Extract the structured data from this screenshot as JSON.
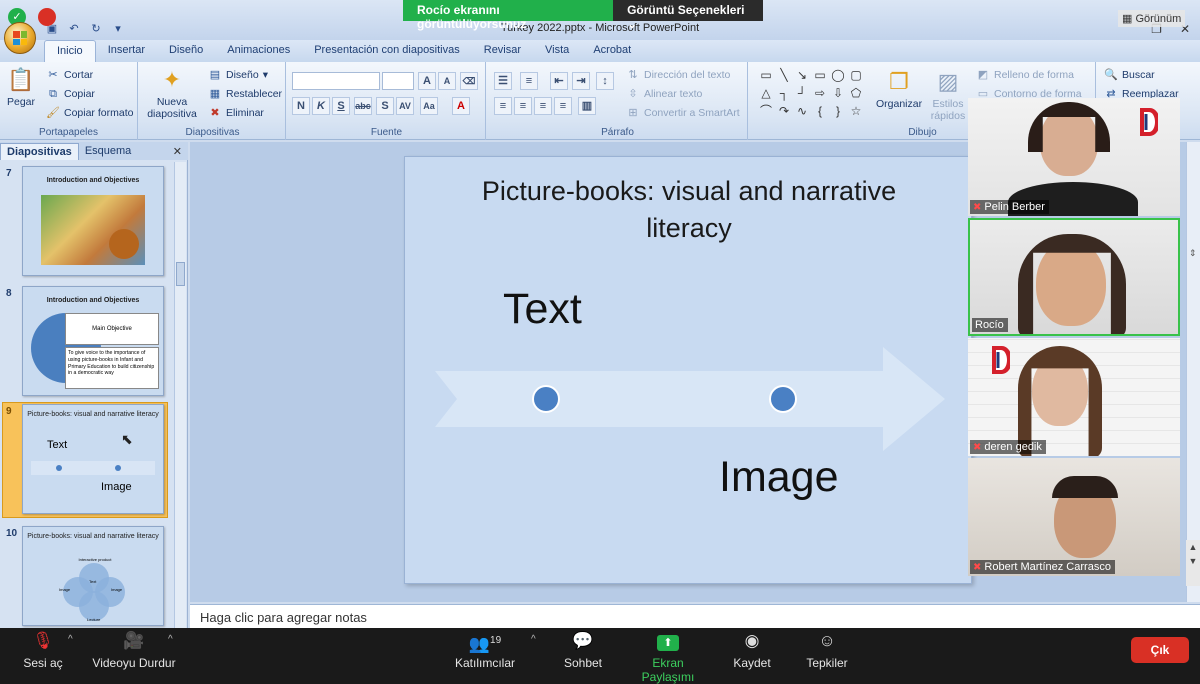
{
  "share_banner": {
    "status": "Rocío ekranını görüntülüyorsunuz",
    "options": "Görüntü Seçenekleri"
  },
  "view_label": "Görünüm",
  "ppt": {
    "window_title": "Turkey 2022.pptx - Microsoft PowerPoint",
    "tabs": [
      "Inicio",
      "Insertar",
      "Diseño",
      "Animaciones",
      "Presentación con diapositivas",
      "Revisar",
      "Vista",
      "Acrobat"
    ],
    "clipboard": {
      "paste": "Pegar",
      "cut": "Cortar",
      "copy": "Copiar",
      "format_painter": "Copiar formato",
      "label": "Portapapeles"
    },
    "slides_group": {
      "new_slide": "Nueva diapositiva",
      "layout": "Diseño",
      "reset": "Restablecer",
      "delete": "Eliminar",
      "label": "Diapositivas"
    },
    "font_group": {
      "label": "Fuente"
    },
    "paragraph_group": {
      "text_direction": "Dirección del texto",
      "align_text": "Alinear texto",
      "smartart": "Convertir a SmartArt",
      "label": "Párrafo"
    },
    "drawing_group": {
      "arrange": "Organizar",
      "quick_styles": "Estilos rápidos",
      "fill": "Relleno de forma",
      "outline": "Contorno de forma",
      "label": "Dibujo"
    },
    "editing_group": {
      "find": "Buscar",
      "replace": "Reemplazar"
    },
    "panel_tabs": {
      "slides": "Diapositivas",
      "outline": "Esquema"
    },
    "thumbnails": [
      {
        "num": "7",
        "title": "Introduction and Objectives"
      },
      {
        "num": "8",
        "title": "Introduction and Objectives",
        "box_title": "Main Objective",
        "box_text": "To give voice to the importance of using picture-books in Infant and Primary  Education to build citizenship in a democratic way"
      },
      {
        "num": "9",
        "title": "Picture-books: visual and narrative literacy",
        "text": "Text",
        "image": "Image"
      },
      {
        "num": "10",
        "title": "Picture-books: visual and narrative literacy",
        "c1": "Interactive product",
        "c2": "Image",
        "c3": "Image",
        "c4": "Text",
        "c5": "Lecture"
      }
    ],
    "slide": {
      "title": "Picture-books: visual and narrative literacy",
      "text_label": "Text",
      "image_label": "Image"
    },
    "notes_placeholder": "Haga clic para agregar notas"
  },
  "participants": [
    {
      "name": "Pelin Berber",
      "muted": true
    },
    {
      "name": "Rocío",
      "muted": false
    },
    {
      "name": "deren gedik",
      "muted": true
    },
    {
      "name": "Robert Martínez Carrasco",
      "muted": true
    }
  ],
  "zoom_toolbar": {
    "unmute": "Sesi aç",
    "stop_video": "Videoyu Durdur",
    "participants": "Katılımcılar",
    "participant_count": "19",
    "chat": "Sohbet",
    "share_screen": "Ekran Paylaşımı",
    "record": "Kaydet",
    "reactions": "Tepkiler",
    "leave": "Çık"
  },
  "colors": {
    "share_green": "#21b04b",
    "leave_red": "#d93025",
    "slide_bg": "#c8daf1",
    "dot": "#4a80c4"
  }
}
